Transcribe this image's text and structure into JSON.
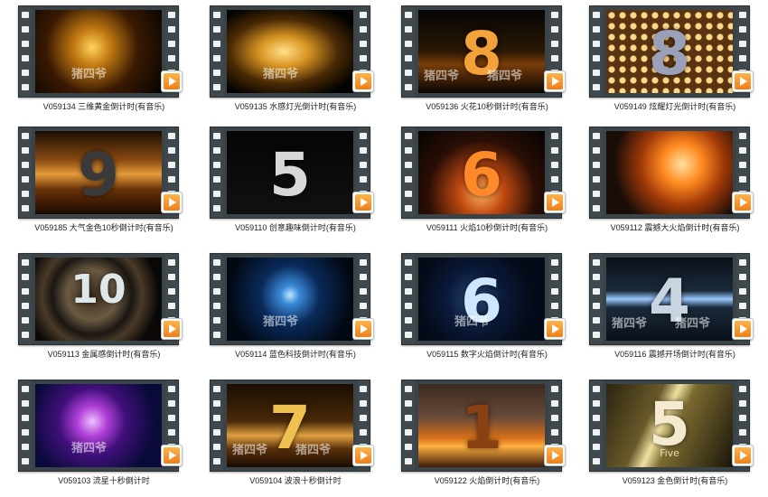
{
  "videos": [
    {
      "label": "V059134 三维黄金倒计时(有音乐)",
      "numeral": "",
      "watermarks": [
        "猪四爷"
      ],
      "bg": "radial-gradient(circle at 45% 45%, #ffd45a 0%, #c27a12 22%, #3a1a02 55%, #050301 100%)",
      "color": "#ffdf6a"
    },
    {
      "label": "V059135 水感灯光倒计时(有音乐)",
      "numeral": "",
      "watermarks": [
        "猪四爷"
      ],
      "bg": "radial-gradient(ellipse at 45% 50%, #ffe08a 0%, #d89522 25%, #4a2a05 55%, #000 85%)",
      "color": "#ffd060"
    },
    {
      "label": "V059136 火花10秒倒计时(有音乐)",
      "numeral": "8",
      "watermarks": [
        "猪四爷",
        "猪四爷"
      ],
      "bg": "linear-gradient(180deg,#050505 0%,#2a1804 50%,#7a3d0a 65%,#0a0603 100%)",
      "color": "#f3a23a"
    },
    {
      "label": "V059149 炫耀灯光倒计时(有音乐)",
      "numeral": "8",
      "watermarks": [],
      "bg": "radial-gradient(circle,#ffd98a 0 3px,#5a3410 4px) 0 0/12px 12px",
      "color": "#9aa0b8"
    },
    {
      "label": "V059185 大气金色10秒倒计时(有音乐)",
      "numeral": "9",
      "watermarks": [],
      "bg": "linear-gradient(180deg,#1a0d03 0%,#8a4a12 35%,#e59a3a 52%,#6a3208 70%,#1a0a02 100%)",
      "color": "#3a3a3a"
    },
    {
      "label": "V059110 创意趣味倒计时(有音乐)",
      "numeral": "5",
      "watermarks": [],
      "bg": "linear-gradient(#050505,#111)",
      "color": "#d8d8d8"
    },
    {
      "label": "V059111 火焰10秒倒计时(有音乐)",
      "numeral": "6",
      "watermarks": [],
      "bg": "radial-gradient(ellipse at 50% 75%, #ffb060 0%, #c04a10 25%, #2a0e05 60%, #050302 100%)",
      "color": "#ff8a2a"
    },
    {
      "label": "V059112 震撼大火焰倒计时(有音乐)",
      "numeral": "",
      "watermarks": [],
      "bg": "radial-gradient(circle at 60% 40%, #ffe0a0 0%, #ff8a20 22%, #a23a08 45%, #1a0d08 75%)",
      "color": "#ffffff"
    },
    {
      "label": "V059113 金属感倒计时(有音乐)",
      "numeral": "10",
      "watermarks": [],
      "bg": "radial-gradient(circle at 45% 45%, #3a2a1a 0%, #6a5a42 30%, #1a1612 48%, #4a3a28 60%, #0a0806 80%)",
      "color": "#dfe8e8"
    },
    {
      "label": "V059114 蓝色科技倒计时(有音乐)",
      "numeral": "",
      "watermarks": [
        "猪四爷"
      ],
      "bg": "radial-gradient(circle at 50% 45%, #bfe8ff 0%, #3a8ad8 12%, #0a2a5a 38%, #020812 80%)",
      "color": "#a8d8ff"
    },
    {
      "label": "V059115 数字火焰倒计时(有音乐)",
      "numeral": "6",
      "watermarks": [
        "猪四爷"
      ],
      "bg": "radial-gradient(circle at 45% 50%, #2a4a7a 0%, #0a1a3a 35%, #050a18 70%), linear-gradient(90deg,#000,#000)",
      "color": "#cfe6ff"
    },
    {
      "label": "V059116 震撼开场倒计时(有音乐)",
      "numeral": "4",
      "watermarks": [
        "猪四爷",
        "猪四爷"
      ],
      "bg": "linear-gradient(180deg,#0a1018 0%,#1a2a3a 40%,#9ac8ff 50%,#1a2a3a 60%,#0a1018 100%)",
      "color": "#c8d4e0"
    },
    {
      "label": "V059103 流星十秒倒计时",
      "numeral": "",
      "watermarks": [
        "猪四爷"
      ],
      "bg": "radial-gradient(circle at 45% 45%, #f0c0ff 0%, #b040d8 18%, #40107a 40%, #0a0a3a 75%)",
      "color": "#ffffff"
    },
    {
      "label": "V059104 波浪十秒倒计时",
      "numeral": "7",
      "watermarks": [
        "猪四爷",
        "猪四爷"
      ],
      "bg": "linear-gradient(180deg,#1a0d02 0%,#4a2a08 45%,#e0a040 62%,#5a300a 78%,#1a0c02 100%)",
      "color": "#f0c050"
    },
    {
      "label": "V059122 火焰倒计时(有音乐)",
      "numeral": "1",
      "watermarks": [],
      "bg": "linear-gradient(180deg,#3a2a20 0%,#6a4a38 40%,#d8701a 65%,#ffb040 75%,#3a1a08 100%)",
      "color": "#8a4010"
    },
    {
      "label": "V059123 金色倒计时(有音乐)",
      "numeral": "5",
      "sub": "Five",
      "watermarks": [],
      "bg": "linear-gradient(115deg,#2a2410 0%,#6a5a2a 35%,#f0e0a0 45%,#7a6a30 55%,#1a160a 100%)",
      "color": "#f4ead0"
    }
  ]
}
